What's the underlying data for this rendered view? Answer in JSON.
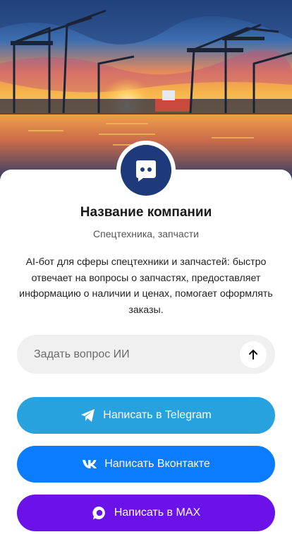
{
  "hero": {
    "image": "port-sunset-cranes"
  },
  "company": {
    "avatar_icon": "chat-bot-icon",
    "name": "Название компании",
    "category": "Спецтехника, запчасти",
    "description": "AI-бот для сферы спецтехники и запчастей: быстро отвечает на вопросы о запчастях, предоставляет информацию о наличии и ценах, помогает оформлять заказы."
  },
  "ask": {
    "placeholder": "Задать вопрос ИИ",
    "value": "",
    "send_icon": "arrow-up-icon"
  },
  "buttons": [
    {
      "label": "Написать в Telegram",
      "icon": "telegram-icon",
      "color": "#27a2df"
    },
    {
      "label": "Написать Вконтакте",
      "icon": "vk-icon",
      "color": "#0a7cfd"
    },
    {
      "label": "Написать в MAX",
      "icon": "max-icon",
      "color": "#6a12e8"
    }
  ],
  "colors": {
    "avatar_bg": "#1f3a7a",
    "input_bg": "#f0f0f0"
  }
}
